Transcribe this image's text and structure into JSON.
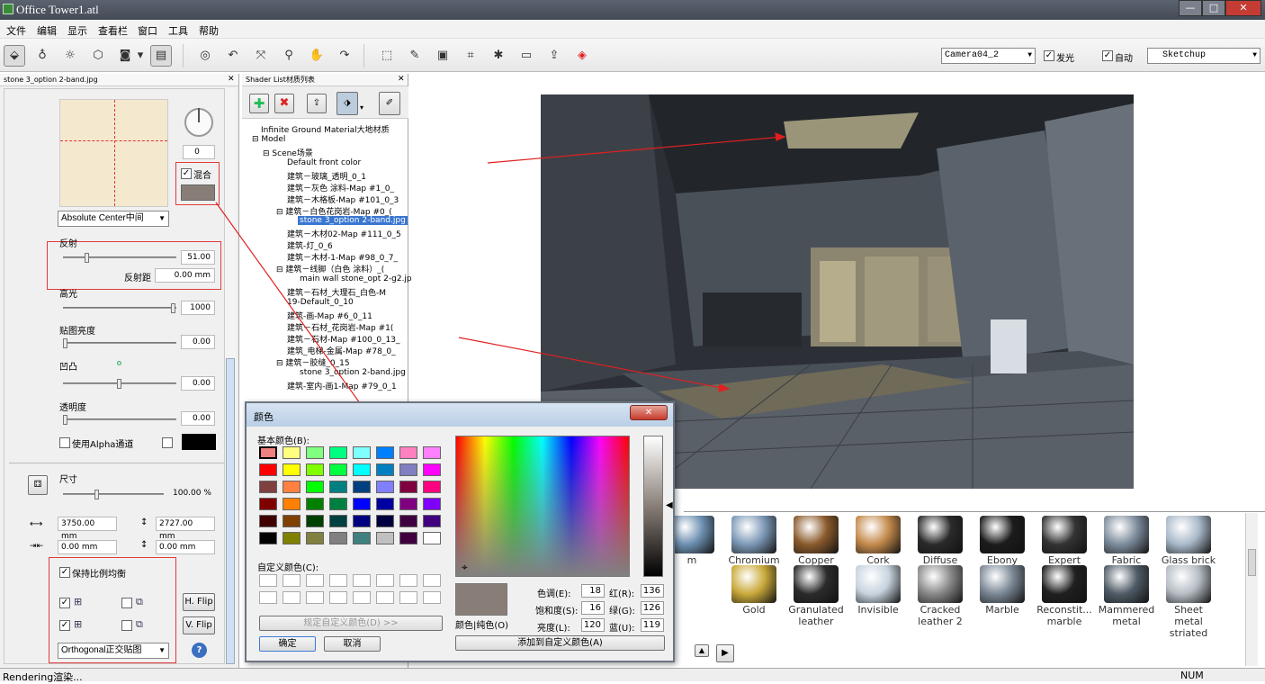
{
  "window": {
    "title": "Office Tower1.atl"
  },
  "menu": [
    "文件",
    "编辑",
    "显示",
    "查看栏",
    "窗口",
    "工具",
    "帮助"
  ],
  "toolbar": {
    "camera": "Camera04_2",
    "glow_label": "发光",
    "glow_checked": true,
    "auto_label": "自动",
    "auto_checked": true,
    "style": "Sketchup"
  },
  "left_panel": {
    "title": "stone 3_option 2-band.jpg",
    "rotation": "0",
    "blend_label": "混合",
    "mapping": "Absolute Center中间",
    "reflection_label": "反射",
    "reflection_value": "51.00",
    "reflection_dist_label": "反射距",
    "reflection_dist_value": "0.00 mm",
    "highlight_label": "高光",
    "highlight_value": "1000",
    "brightness_label": "贴图亮度",
    "brightness_value": "0.00",
    "bump_label": "凹凸",
    "bump_value": "0.00",
    "transparency_label": "透明度",
    "transparency_value": "0.00",
    "alpha_label": "使用Alpha通道",
    "size_label": "尺寸",
    "size_value": "100.00 %",
    "width": "3750.00 mm",
    "height": "2727.00 mm",
    "offset_x": "0.00 mm",
    "offset_y": "0.00 mm",
    "keep_ratio_label": "保持比例均衡",
    "hflip": "H. Flip",
    "vflip": "V. Flip",
    "projection": "Orthogonal正交贴图",
    "help": "?"
  },
  "shader_panel": {
    "title": "Shader List材质列表",
    "tree": [
      "Infinite Ground Material大地材质",
      "Model",
      "Scene场景",
      "Default front color",
      "建筑－玻璃_透明_0_1",
      "建筑－灰色 涂料-Map #1_0_",
      "建筑－木格板-Map #101_0_3",
      "建筑－白色花岗岩-Map #0_(",
      "stone 3_option 2-band.jpg",
      "建筑－木材02-Map #111_0_5",
      "建筑-灯_0_6",
      "建筑－木材-1-Map #98_0_7_",
      "建筑－线脚（白色 涂料）_(",
      "main wall stone_opt 2-g2.jp",
      "建筑－石材_大理石_白色-M",
      "19-Default_0_10",
      "建筑-画-Map #6_0_11",
      "建筑－石材_花岗岩-Map #1(",
      "建筑－石材-Map #100_0_13_",
      "建筑_电梯-金属-Map #78_0_",
      "建筑－胶缝_0_15",
      "stone 3_option 2-band.jpg",
      "建筑-室内-画1-Map #79_0_1"
    ]
  },
  "color_dialog": {
    "title": "颜色",
    "basic_label": "基本颜色(B):",
    "custom_label": "自定义颜色(C):",
    "define_custom": "规定自定义颜色(D) >>",
    "ok": "确定",
    "cancel": "取消",
    "solid_label": "颜色|纯色(O)",
    "hue_label": "色调(E):",
    "hue": "18",
    "sat_label": "饱和度(S):",
    "sat": "16",
    "lum_label": "亮度(L):",
    "lum": "120",
    "red_label": "红(R):",
    "red": "136",
    "green_label": "绿(G):",
    "green": "126",
    "blue_label": "蓝(U):",
    "blue": "119",
    "add_custom": "添加到自定义颜色(A)",
    "selected_color": "#887e77"
  },
  "materials": [
    {
      "name": "m",
      "color": "#6c8fb0"
    },
    {
      "name": "Chromium",
      "color": "#7c98b6"
    },
    {
      "name": "Copper",
      "color": "#8a5a2c"
    },
    {
      "name": "Cork",
      "color": "#c48a4c"
    },
    {
      "name": "Diffuse Fresnel",
      "color": "#2a2a2a"
    },
    {
      "name": "Ebony",
      "color": "#1c1c1c"
    },
    {
      "name": "Expert",
      "color": "#333333"
    },
    {
      "name": "Fabric",
      "color": "#7d8c9c"
    },
    {
      "name": "Glass brick",
      "color": "#a9b9c9"
    },
    {
      "name": "Gold",
      "color": "#c9a93a"
    },
    {
      "name": "Granulated leather",
      "color": "#2b2b2b"
    },
    {
      "name": "Invisible",
      "color": "#c7d3de"
    },
    {
      "name": "Cracked leather 2",
      "color": "#888888"
    },
    {
      "name": "Marble",
      "color": "#7a8795"
    },
    {
      "name": "Reconstit... marble",
      "color": "#202020"
    },
    {
      "name": "Mammered metal",
      "color": "#4f5b66"
    },
    {
      "name": "Sheet metal striated",
      "color": "#b5bcc3"
    }
  ],
  "status": {
    "text": "Rendering渲染...",
    "num": "NUM"
  }
}
